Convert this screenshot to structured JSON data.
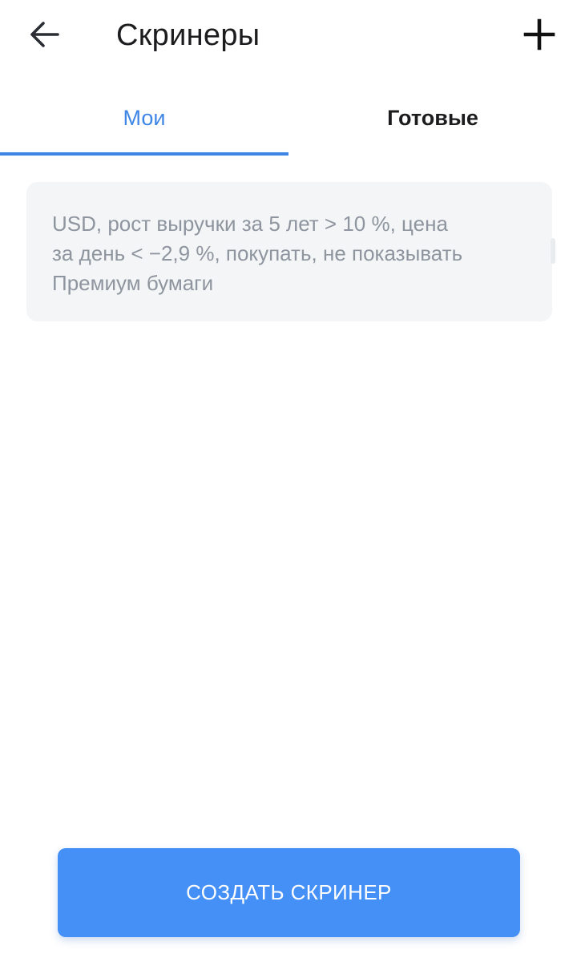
{
  "header": {
    "title": "Скринеры",
    "back_icon": "arrow-left-icon",
    "add_icon": "plus-icon"
  },
  "tabs": [
    {
      "label": "Мои",
      "active": true
    },
    {
      "label": "Готовые",
      "active": false
    }
  ],
  "screeners": [
    {
      "line1": "USD, рост выручки за 5 лет > 10 %, цена",
      "line2": "за день < −2,9 %, покупать, не показывать",
      "line3": "Премиум бумаги"
    }
  ],
  "actions": {
    "create_label": "СОЗДАТЬ СКРИНЕР"
  },
  "colors": {
    "accent": "#3d86e6",
    "button": "#4590f7",
    "card_bg": "#f3f5f7",
    "card_text": "#8e959e",
    "text_primary": "#1c1c1e"
  }
}
